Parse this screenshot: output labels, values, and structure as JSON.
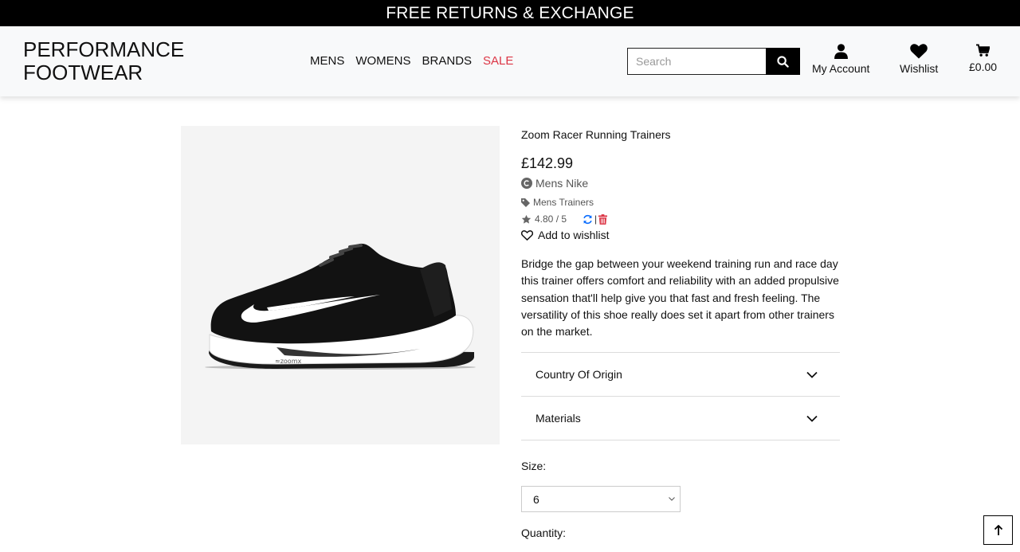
{
  "banner": {
    "text": "FREE RETURNS & EXCHANGE"
  },
  "header": {
    "logo_line1": "PERFORMANCE",
    "logo_line2": "FOOTWEAR",
    "nav": {
      "mens": "MENS",
      "womens": "WOMENS",
      "brands": "BRANDS",
      "sale": "SALE"
    },
    "search": {
      "placeholder": "Search",
      "icon": "search-icon"
    },
    "account": {
      "label": "My Account",
      "icon": "user-icon"
    },
    "wishlist": {
      "label": "Wishlist",
      "icon": "heart-icon"
    },
    "cart": {
      "total": "£0.00",
      "icon": "cart-icon"
    }
  },
  "product": {
    "title": "Zoom Racer Running Trainers",
    "price": "£142.99",
    "brand": "Mens Nike",
    "category": "Mens Trainers",
    "rating": "4.80 / 5",
    "action_separator": "|",
    "wishlist_label": "Add to wishlist",
    "description": "Bridge the gap between your weekend training run and race day this trainer offers comfort and reliability with an added propulsive sensation that'll help give you that fast and fresh feeling. The versatility of this shoe really does set it apart from other trainers on the market.",
    "accordion": [
      {
        "label": "Country Of Origin"
      },
      {
        "label": "Materials"
      }
    ],
    "size_label": "Size:",
    "size_value": "6",
    "quantity_label": "Quantity:"
  },
  "colors": {
    "sale": "#dc3545",
    "banner_bg": "#000000",
    "header_bg": "#f8f9fa",
    "image_bg": "#f4f4f4",
    "update_icon": "#0d6efd",
    "delete_icon": "#dc3545"
  }
}
